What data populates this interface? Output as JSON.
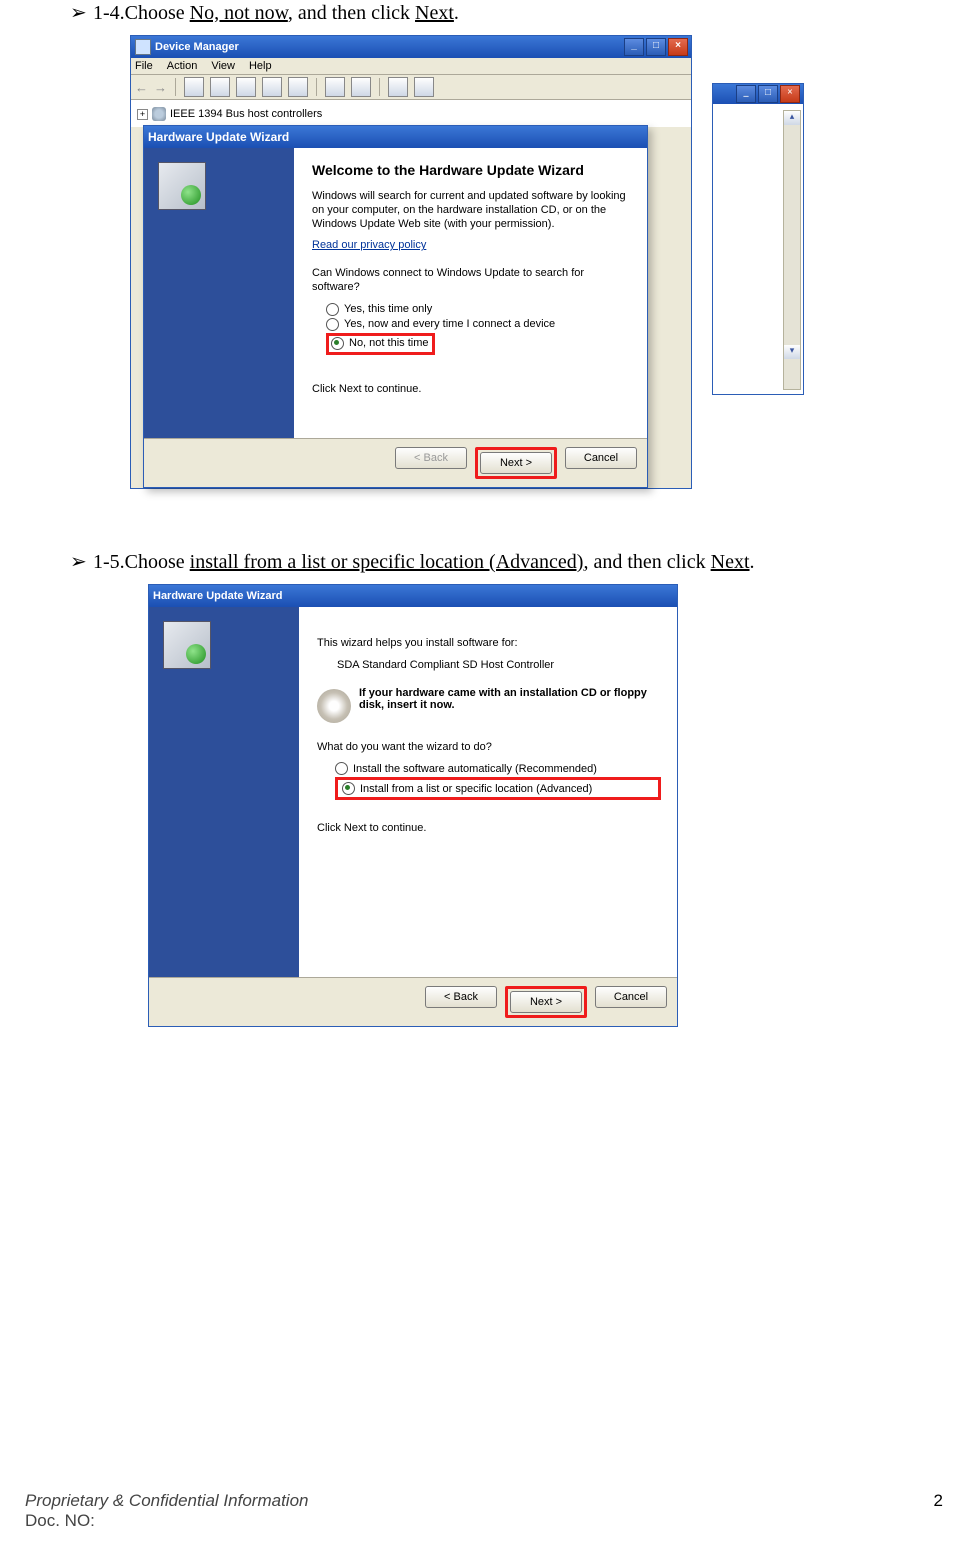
{
  "step1": {
    "prefix": "1-4.Choose ",
    "link1": "No, not now",
    "mid": ", and then click ",
    "link2": "Next",
    "suffix": "."
  },
  "step2": {
    "prefix": "1-5.Choose ",
    "link1": "install from a list or specific location (Advanced)",
    "mid": ", and then click ",
    "link2": "Next",
    "suffix": "."
  },
  "deviceManager": {
    "title": "Device Manager",
    "menu": {
      "file": "File",
      "action": "Action",
      "view": "View",
      "help": "Help"
    },
    "tree_item": "IEEE 1394 Bus host controllers"
  },
  "wizard1": {
    "title": "Hardware Update Wizard",
    "heading": "Welcome to the Hardware Update Wizard",
    "intro": "Windows will search for current and updated software by looking on your computer, on the hardware installation CD, or on the Windows Update Web site (with your permission).",
    "privacy": "Read our privacy policy",
    "question": "Can Windows connect to Windows Update to search for software?",
    "opt1": "Yes, this time only",
    "opt2": "Yes, now and every time I connect a device",
    "opt3": "No, not this time",
    "continue": "Click Next to continue.",
    "btn_back": "< Back",
    "btn_next": "Next >",
    "btn_cancel": "Cancel"
  },
  "wizard2": {
    "title": "Hardware Update Wizard",
    "helps": "This wizard helps you install software for:",
    "device": "SDA Standard Compliant SD Host Controller",
    "cd_text": "If your hardware came with an installation CD or floppy disk, insert it now.",
    "question": "What do you want the wizard to do?",
    "opt1": "Install the software automatically (Recommended)",
    "opt2": "Install from a list or specific location (Advanced)",
    "continue": "Click Next to continue.",
    "btn_back": "< Back",
    "btn_next": "Next >",
    "btn_cancel": "Cancel"
  },
  "footer": {
    "confidential": "Proprietary & Confidential Information",
    "doc_label": "Doc. NO:",
    "page": "2"
  }
}
